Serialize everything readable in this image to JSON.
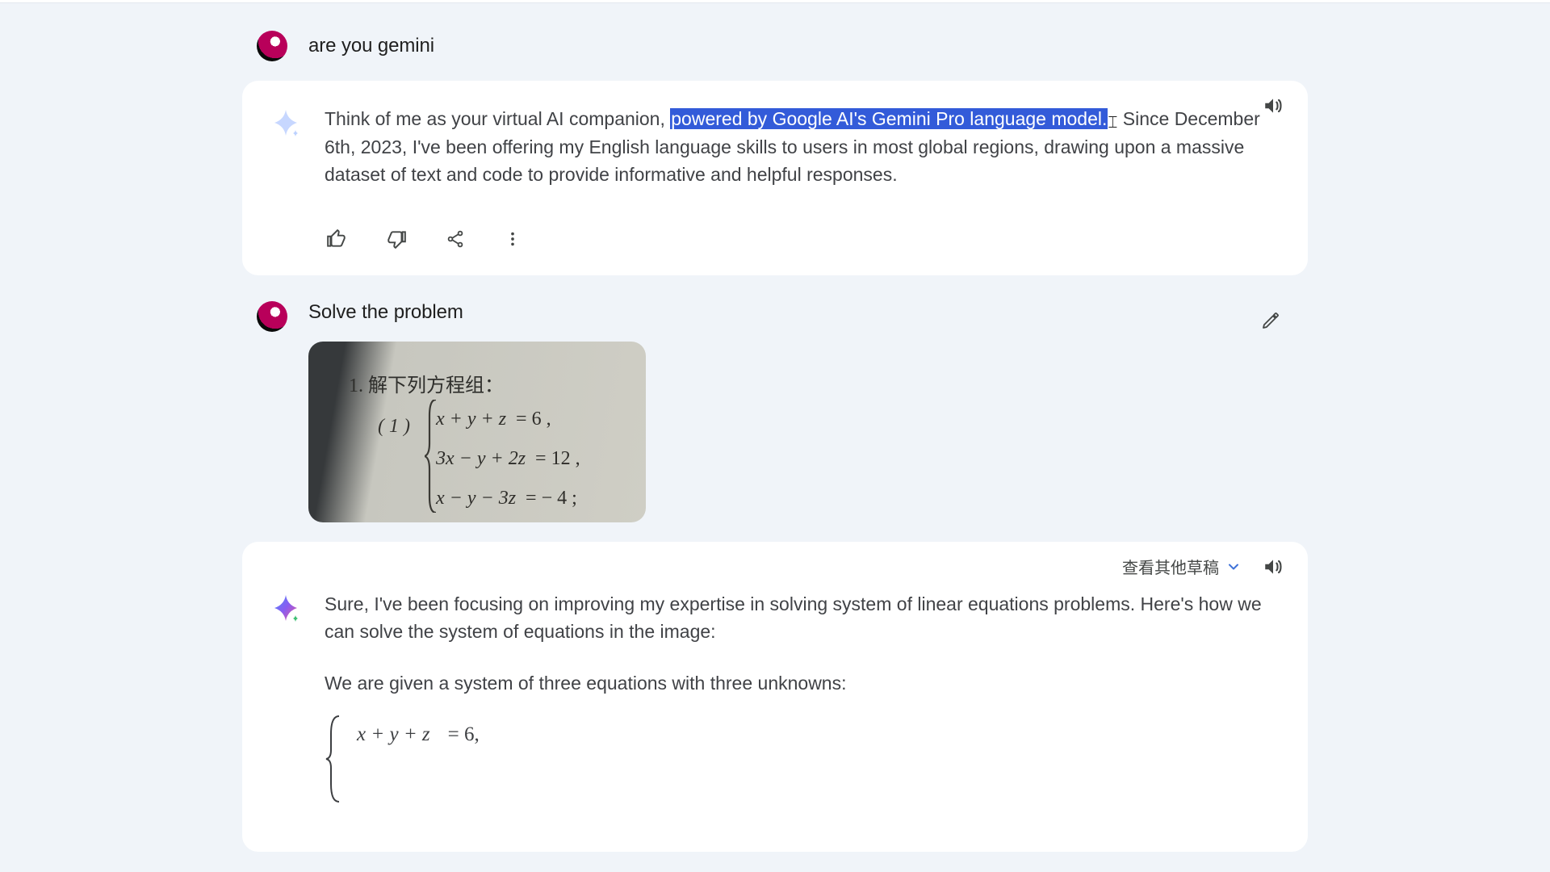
{
  "user1": {
    "text": "are you gemini"
  },
  "answer1": {
    "pre": "Think of me as your virtual AI companion, ",
    "highlight": "powered by Google AI's Gemini Pro language model.",
    "post": " Since December 6th, 2023, I've been offering my English language skills to users in most global regions, drawing upon a massive dataset of text and code to provide informative and helpful responses."
  },
  "user2": {
    "text": "Solve the problem",
    "problem": {
      "heading": "1.  解下列方程组：",
      "label": "( 1 )",
      "eq1_lhs": "x + y + z",
      "eq1_rhs": "= 6 ,",
      "eq2_lhs": "3x − y + 2z",
      "eq2_rhs": "= 12 ,",
      "eq3_lhs": "x − y − 3z",
      "eq3_rhs": "= − 4 ;"
    }
  },
  "answer2": {
    "drafts_label": "查看其他草稿",
    "line1": "Sure, I've been focusing on improving my expertise in solving system of linear equations problems. Here's how we can solve the system of equations in the image:",
    "line2": "We are given a system of three equations with three unknowns:",
    "sys": {
      "r1_lhs": "x + y + z",
      "r1_rhs": "= 6,"
    }
  }
}
